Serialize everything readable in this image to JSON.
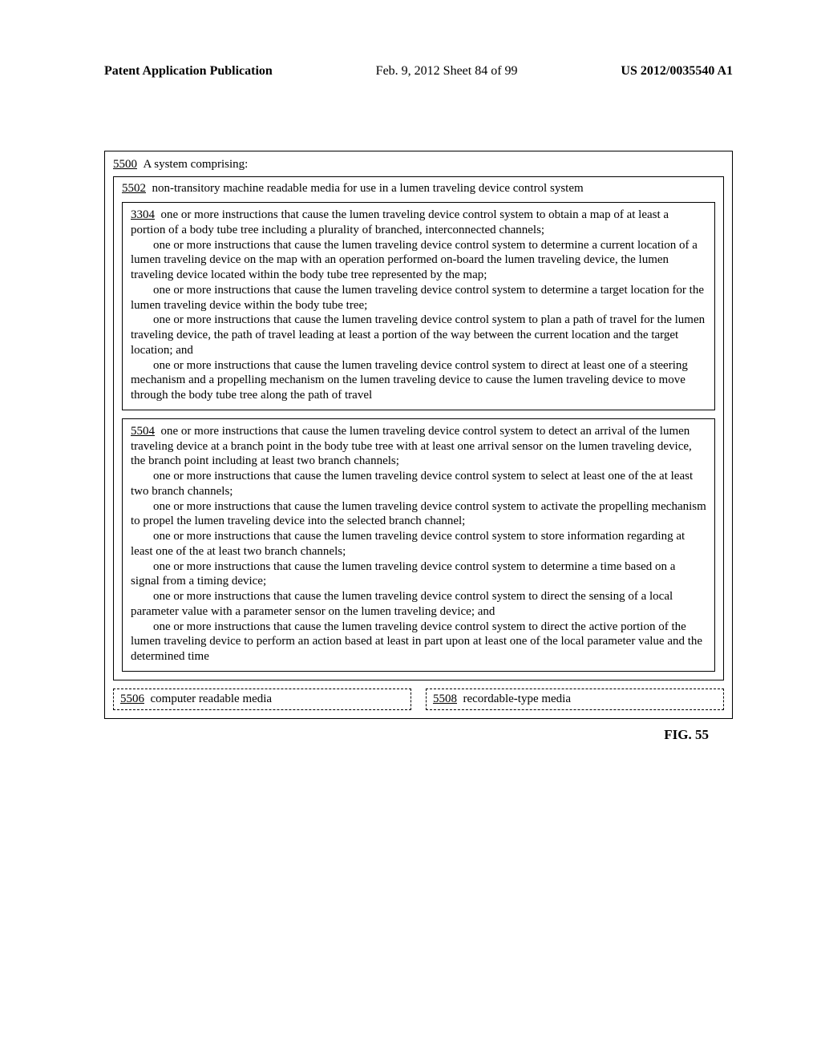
{
  "header": {
    "left": "Patent Application Publication",
    "center": "Feb. 9, 2012  Sheet 84 of 99",
    "right": "US 2012/0035540 A1"
  },
  "box5500": {
    "ref": "5500",
    "title": "A system comprising:"
  },
  "box5502": {
    "ref": "5502",
    "title": "non-transitory machine readable media for use in a lumen traveling device control system"
  },
  "box3304": {
    "ref": "3304",
    "p1": "one or more instructions that cause the lumen traveling device control system to obtain a map of at least a portion of a body tube tree including a plurality of branched, interconnected channels;",
    "p2": "one or more instructions that cause the lumen traveling device control system to determine a current location of a lumen traveling device on the map with an operation performed on-board the lumen traveling device, the lumen traveling device located within the body tube tree represented by the map;",
    "p3": "one or more instructions that cause the lumen traveling device control system to determine a target location for the lumen traveling device within the body tube tree;",
    "p4": "one or more instructions that cause the lumen traveling device control system to plan a path of travel for the lumen traveling device, the path of travel leading at least a portion of the way between the current location and the target location; and",
    "p5": "one or more instructions that cause the lumen traveling device control system to direct at least one of a steering mechanism and a propelling mechanism on the lumen traveling device to cause the lumen traveling device to move through the body tube tree along the path of travel"
  },
  "box5504": {
    "ref": "5504",
    "p1": "one or more instructions that cause the lumen traveling device control system to detect an arrival of the lumen traveling device at a branch point in the body tube tree with at least one arrival sensor on the lumen traveling device, the branch point including at least two branch channels;",
    "p2": "one or more instructions that cause the lumen traveling device control system to select at least one of the at least two branch channels;",
    "p3": "one or more instructions that cause the lumen traveling device control system to activate the propelling mechanism to propel the lumen traveling device into the selected branch channel;",
    "p4": "one or more instructions that cause the lumen traveling device control system to store information regarding at least one of the at least two branch channels;",
    "p5": "one or more instructions that cause the lumen traveling device control system to determine a time based on a signal from a timing device;",
    "p6": "one or more instructions that cause the lumen traveling device control system to direct the sensing of a local parameter value with a parameter sensor on the lumen traveling device; and",
    "p7": "one or more instructions that cause the lumen traveling device control system to direct the active portion of the lumen traveling device to perform an action based at least in part upon at least one of the local parameter value and the determined time"
  },
  "box5506": {
    "ref": "5506",
    "title": "computer readable media"
  },
  "box5508": {
    "ref": "5508",
    "title": "recordable-type media"
  },
  "figure_label": "FIG. 55"
}
